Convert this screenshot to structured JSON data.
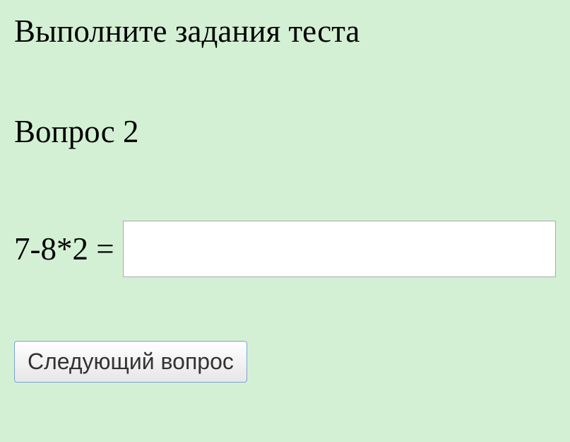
{
  "instruction": "Выполните задания теста",
  "question_heading": "Вопрос 2",
  "question": {
    "expression": "7-8*2 =",
    "answer_value": ""
  },
  "buttons": {
    "next_label": "Следующий вопрос"
  }
}
